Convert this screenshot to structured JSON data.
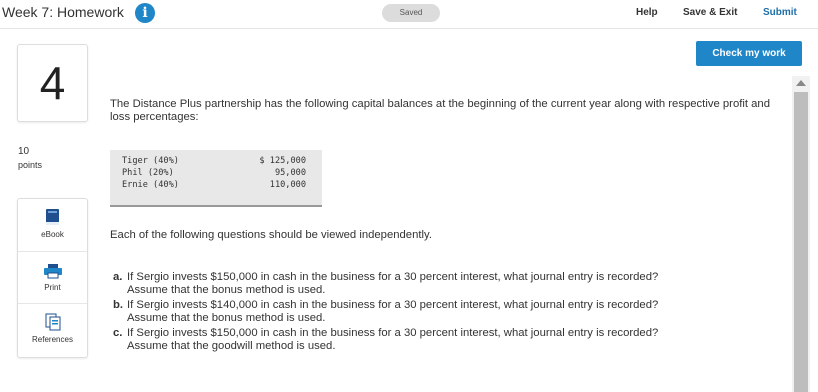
{
  "header": {
    "title": "Week 7: Homework",
    "saved_label": "Saved",
    "help_label": "Help",
    "save_exit_label": "Save & Exit",
    "submit_label": "Submit",
    "info_glyph": "i"
  },
  "actions": {
    "check_label": "Check my work"
  },
  "question": {
    "number": "4",
    "points_value": "10",
    "points_label": "points",
    "prompt": "The Distance Plus partnership has the following capital balances at the beginning of the current year along with respective profit and loss percentages:",
    "capital": [
      {
        "name": "Tiger (40%)",
        "amount": "$ 125,000"
      },
      {
        "name": "Phil (20%)",
        "amount": "95,000"
      },
      {
        "name": "Ernie (40%)",
        "amount": "110,000"
      }
    ],
    "independent_note": "Each of the following questions should be viewed independently.",
    "parts": [
      {
        "letter": "a.",
        "line1": "If Sergio invests $150,000 in cash in the business for a 30 percent interest, what journal entry is recorded?",
        "line2": "Assume that the bonus method is used."
      },
      {
        "letter": "b.",
        "line1": "If Sergio invests $140,000 in cash in the business for a 30 percent interest, what journal entry is recorded?",
        "line2": "Assume that the bonus method is used."
      },
      {
        "letter": "c.",
        "line1": "If Sergio invests $150,000 in cash in the business for a 30 percent interest, what journal entry is recorded?",
        "line2": "Assume that the goodwill method is used."
      }
    ]
  },
  "tools": [
    {
      "label": "eBook",
      "icon": "book-icon"
    },
    {
      "label": "Print",
      "icon": "printer-icon"
    },
    {
      "label": "References",
      "icon": "references-icon"
    }
  ],
  "colors": {
    "accent": "#1f86c8",
    "submit": "#1f6fa8"
  }
}
